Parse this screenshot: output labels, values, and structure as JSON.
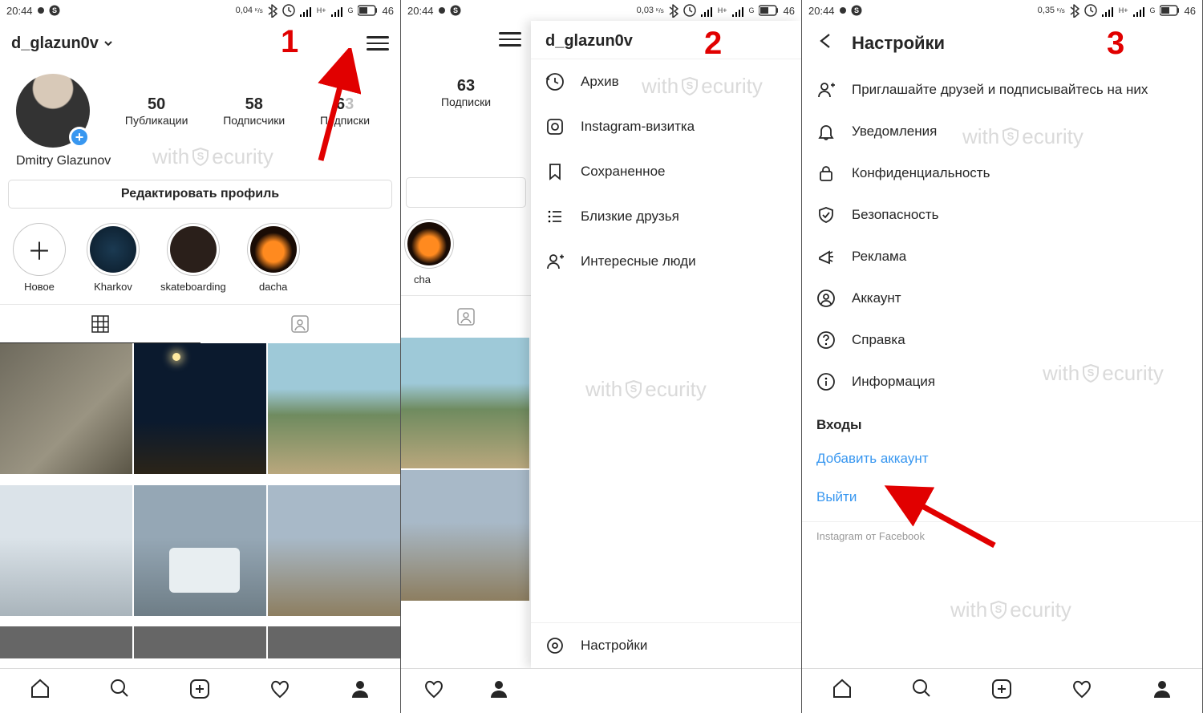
{
  "status": {
    "time": "20:44",
    "speed1": "0,04",
    "speed2": "0,03",
    "speed3": "0,35",
    "speed_unit": "ᴷ/s",
    "battery": "46"
  },
  "annotations": {
    "n1": "1",
    "n2": "2",
    "n3": "3"
  },
  "watermark": {
    "pre": "with",
    "post": "ecurity"
  },
  "screen1": {
    "username": "d_glazun0v",
    "name": "Dmitry Glazunov",
    "stats": {
      "posts_num": "50",
      "posts_lbl": "Публикации",
      "followers_num": "58",
      "followers_lbl": "Подписчики",
      "following_num": "6",
      "following_num_hidden": "3",
      "following_lbl": "Подписки"
    },
    "edit": "Редактировать профиль",
    "highlights": [
      {
        "label": "Новое"
      },
      {
        "label": "Kharkov"
      },
      {
        "label": "skateboarding"
      },
      {
        "label": "dacha"
      }
    ]
  },
  "screen2": {
    "username": "d_glazun0v",
    "following_num": "63",
    "following_lbl": "Подписки",
    "hl_label": "cha",
    "menu": [
      {
        "label": "Архив"
      },
      {
        "label": "Instagram-визитка"
      },
      {
        "label": "Сохраненное"
      },
      {
        "label": "Близкие друзья"
      },
      {
        "label": "Интересные люди"
      }
    ],
    "settings": "Настройки"
  },
  "screen3": {
    "title": "Настройки",
    "items": [
      {
        "label": "Приглашайте друзей и подписывайтесь на них"
      },
      {
        "label": "Уведомления"
      },
      {
        "label": "Конфиденциальность"
      },
      {
        "label": "Безопасность"
      },
      {
        "label": "Реклама"
      },
      {
        "label": "Аккаунт"
      },
      {
        "label": "Справка"
      },
      {
        "label": "Информация"
      }
    ],
    "logins_header": "Входы",
    "add_account": "Добавить аккаунт",
    "logout": "Выйти",
    "footer": "Instagram от Facebook"
  }
}
